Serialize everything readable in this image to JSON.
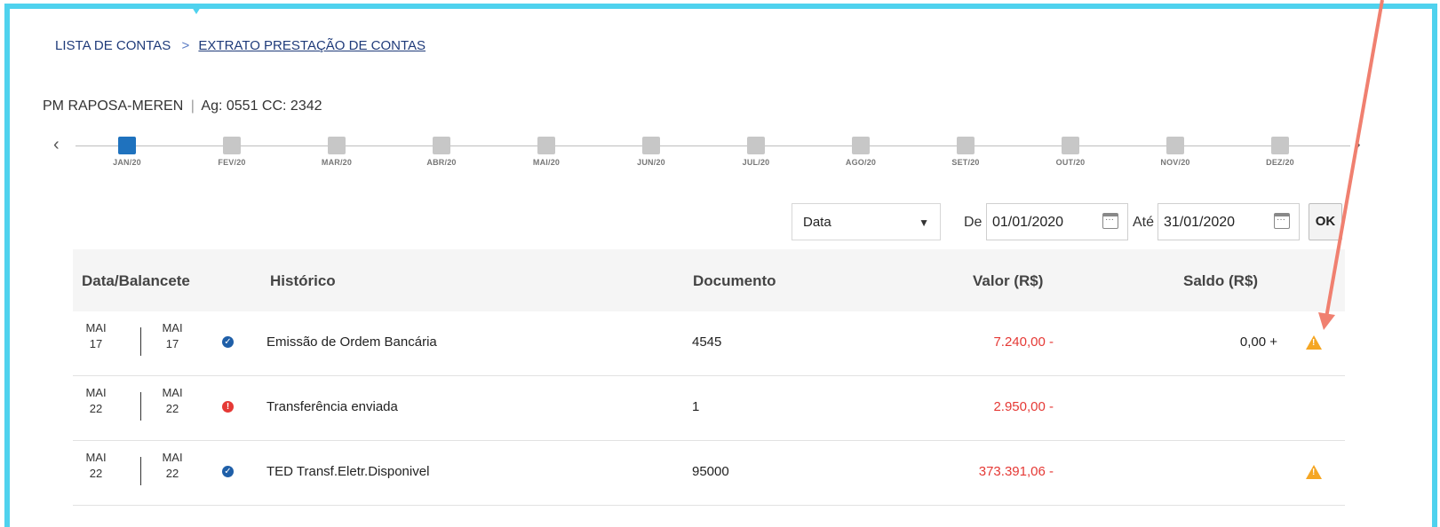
{
  "breadcrumb": {
    "first": "LISTA DE CONTAS",
    "separator": ">",
    "current": "EXTRATO PRESTAÇÃO DE CONTAS"
  },
  "account": {
    "name": "PM RAPOSA-MEREN",
    "separator": "|",
    "details": "Ag: 0551 CC: 2342"
  },
  "timeline": {
    "prev": "‹",
    "next": "›",
    "active_index": 0,
    "months": [
      "JAN/20",
      "FEV/20",
      "MAR/20",
      "ABR/20",
      "MAI/20",
      "JUN/20",
      "JUL/20",
      "AGO/20",
      "SET/20",
      "OUT/20",
      "NOV/20",
      "DEZ/20"
    ]
  },
  "filter": {
    "select_value": "Data",
    "from_label": "De",
    "from_value": "01/01/2020",
    "to_label": "Até",
    "to_value": "31/01/2020",
    "ok_label": "OK"
  },
  "table": {
    "headers": {
      "date": "Data/Balancete",
      "history": "Histórico",
      "document": "Documento",
      "value": "Valor (R$)",
      "balance": "Saldo (R$)"
    },
    "rows": [
      {
        "d1": "MAI",
        "d1n": "17",
        "d2": "MAI",
        "d2n": "17",
        "status": "ok",
        "history": "Emissão de Ordem Bancária",
        "document": "4545",
        "value": "7.240,00 -",
        "balance": "0,00 +",
        "warning": true
      },
      {
        "d1": "MAI",
        "d1n": "22",
        "d2": "MAI",
        "d2n": "22",
        "status": "error",
        "history": "Transferência enviada",
        "document": "1",
        "value": "2.950,00 -",
        "balance": "",
        "warning": false
      },
      {
        "d1": "MAI",
        "d1n": "22",
        "d2": "MAI",
        "d2n": "22",
        "status": "ok",
        "history": "TED Transf.Eletr.Disponivel",
        "document": "95000",
        "value": "373.391,06 -",
        "balance": "",
        "warning": true
      }
    ]
  },
  "colors": {
    "frame": "#4fd2ee",
    "active_month": "#1f72be",
    "negative_value": "#e53935",
    "warning": "#f5a623",
    "annotation_arrow": "#f08070"
  },
  "icons": {
    "status_ok": "check-circle-icon",
    "status_error": "exclamation-circle-icon",
    "warning": "warning-triangle-icon",
    "calendar": "calendar-icon",
    "dropdown": "caret-down-icon"
  }
}
